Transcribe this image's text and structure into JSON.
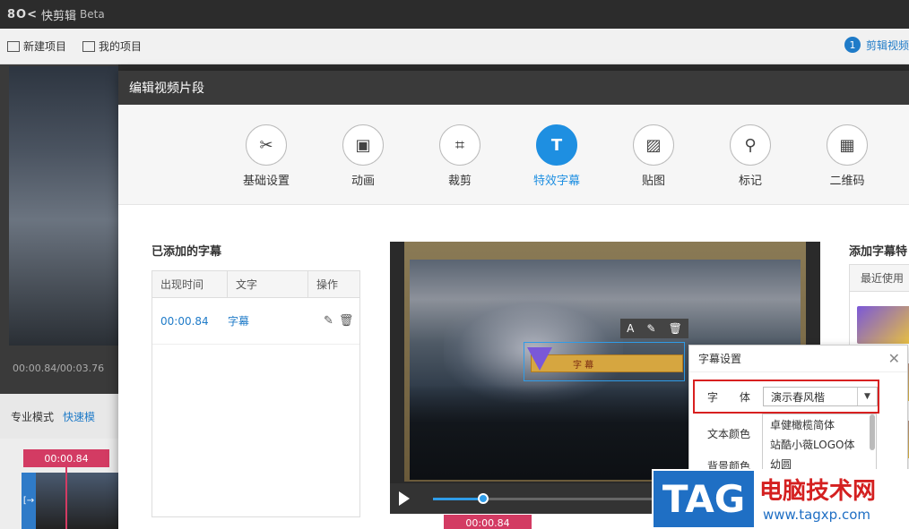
{
  "app": {
    "logo": "8O<",
    "name": "快剪辑",
    "edition": "Beta"
  },
  "toolbar": {
    "new_project": "新建项目",
    "my_projects": "我的项目"
  },
  "step": {
    "number": "1",
    "label": "剪辑视频"
  },
  "background": {
    "time": "00:00.84/00:03.76",
    "mode_pro": "专业模式",
    "mode_fast": "快速模",
    "timeline_time": "00:00.84"
  },
  "dialog": {
    "title": "编辑视频片段",
    "tabs": [
      {
        "label": "基础设置",
        "icon": "scissors-icon"
      },
      {
        "label": "动画",
        "icon": "animation-icon"
      },
      {
        "label": "裁剪",
        "icon": "crop-icon"
      },
      {
        "label": "特效字幕",
        "icon": "text-icon"
      },
      {
        "label": "贴图",
        "icon": "image-icon"
      },
      {
        "label": "标记",
        "icon": "pin-icon"
      },
      {
        "label": "二维码",
        "icon": "qrcode-icon"
      }
    ],
    "active_tab": "特效字幕",
    "added_title": "已添加的字幕",
    "table": {
      "headers": [
        "出现时间",
        "文字",
        "操作"
      ],
      "rows": [
        {
          "time": "00:00.84",
          "text": "字幕"
        }
      ]
    },
    "preview_time": "00:00.84",
    "subtitle_text": "字 幕",
    "right_title": "添加字幕特",
    "right_tab": "最近使用"
  },
  "popup": {
    "title": "字幕设置",
    "font_label": "字 体",
    "font_value": "演示春风楷",
    "font_options": [
      "卓健橄榄简体",
      "站酷小薇LOGO体",
      "幼圆"
    ],
    "text_color_label": "文本颜色",
    "bg_color_label": "背景颜色"
  },
  "watermark": {
    "tag": "TAG",
    "title": "电脑技术网",
    "url": "www.tagxp.com"
  },
  "colors": {
    "accent": "#1e8fe1",
    "highlight": "#d82020",
    "marker": "#d33b63"
  }
}
